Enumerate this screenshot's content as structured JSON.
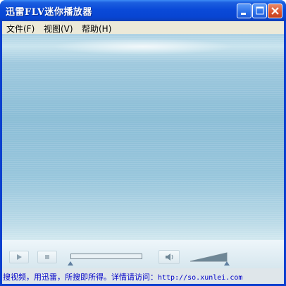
{
  "window": {
    "title": "迅雷FLV迷你播放器"
  },
  "menu": {
    "items": [
      {
        "label": "文件(F)"
      },
      {
        "label": "视图(V)"
      },
      {
        "label": "帮助(H)"
      }
    ]
  },
  "controls": {
    "play_icon": "play-icon",
    "stop_icon": "stop-icon",
    "volume_icon": "speaker-icon",
    "progress": 0,
    "volume": 1.0
  },
  "status": {
    "text": "搜视频，用迅雷，所搜即所得。详情请访问：",
    "url": "http://so.xunlei.com"
  },
  "colors": {
    "titlebar": "#0a4ad8",
    "menubar": "#ece9d8",
    "video": "#8bbdd6",
    "status_text": "#0000c8"
  }
}
